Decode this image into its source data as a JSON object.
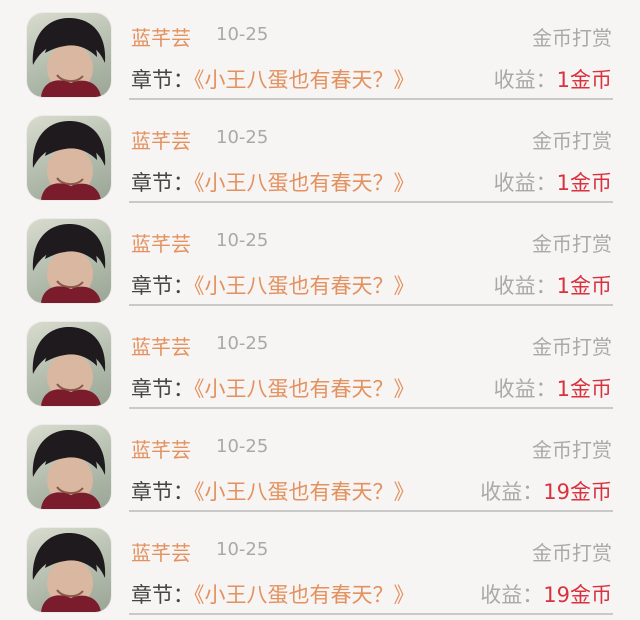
{
  "rows": [
    {
      "name": "蓝芊芸",
      "date": "10-25",
      "tip": "金币打赏",
      "chapter_label": "章节：",
      "chapter_title": "《小王八蛋也有春天？》",
      "earn_label": "收益：",
      "earn_value": "1金币"
    },
    {
      "name": "蓝芊芸",
      "date": "10-25",
      "tip": "金币打赏",
      "chapter_label": "章节：",
      "chapter_title": "《小王八蛋也有春天？》",
      "earn_label": "收益：",
      "earn_value": "1金币"
    },
    {
      "name": "蓝芊芸",
      "date": "10-25",
      "tip": "金币打赏",
      "chapter_label": "章节：",
      "chapter_title": "《小王八蛋也有春天？》",
      "earn_label": "收益：",
      "earn_value": "1金币"
    },
    {
      "name": "蓝芊芸",
      "date": "10-25",
      "tip": "金币打赏",
      "chapter_label": "章节：",
      "chapter_title": "《小王八蛋也有春天？》",
      "earn_label": "收益：",
      "earn_value": "1金币"
    },
    {
      "name": "蓝芊芸",
      "date": "10-25",
      "tip": "金币打赏",
      "chapter_label": "章节：",
      "chapter_title": "《小王八蛋也有春天？》",
      "earn_label": "收益：",
      "earn_value": "19金币"
    },
    {
      "name": "蓝芊芸",
      "date": "10-25",
      "tip": "金币打赏",
      "chapter_label": "章节：",
      "chapter_title": "《小王八蛋也有春天？》",
      "earn_label": "收益：",
      "earn_value": "19金币"
    }
  ],
  "colors": {
    "name": "#e3915e",
    "date": "#a9a9a9",
    "earn_value": "#d9323f",
    "divider": "#c9c9c9",
    "background": "#f7f4f4"
  }
}
